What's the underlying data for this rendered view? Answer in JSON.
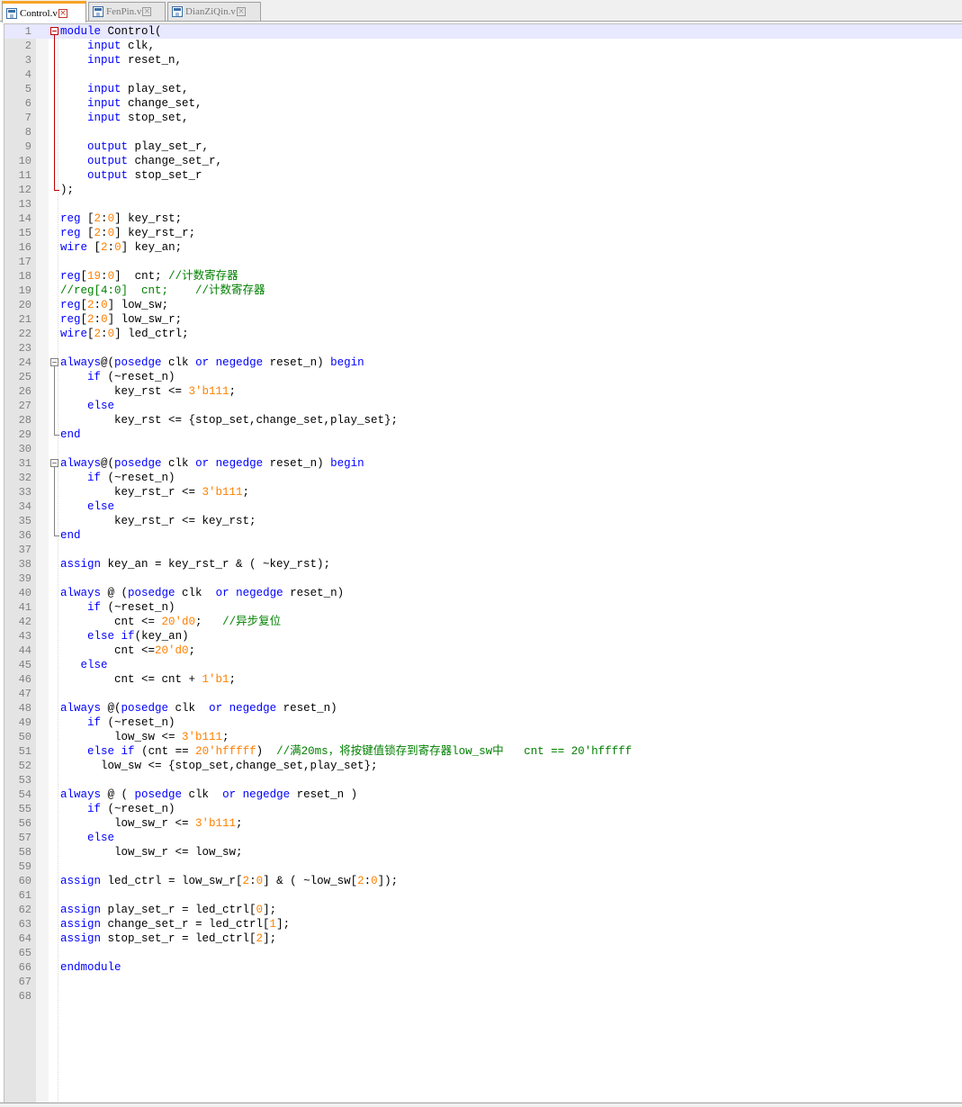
{
  "tabs": [
    {
      "label": "Control.v",
      "active": true
    },
    {
      "label": "FenPin.v",
      "active": false
    },
    {
      "label": "DianZiQin.v",
      "active": false
    }
  ],
  "current_line": 1,
  "lines": [
    [
      [
        "kw",
        "module"
      ],
      [
        "t",
        " Control("
      ]
    ],
    [
      [
        "t",
        "    "
      ],
      [
        "kw",
        "input"
      ],
      [
        "t",
        " clk,"
      ]
    ],
    [
      [
        "t",
        "    "
      ],
      [
        "kw",
        "input"
      ],
      [
        "t",
        " reset_n,"
      ]
    ],
    [],
    [
      [
        "t",
        "    "
      ],
      [
        "kw",
        "input"
      ],
      [
        "t",
        " play_set,"
      ]
    ],
    [
      [
        "t",
        "    "
      ],
      [
        "kw",
        "input"
      ],
      [
        "t",
        " change_set,"
      ]
    ],
    [
      [
        "t",
        "    "
      ],
      [
        "kw",
        "input"
      ],
      [
        "t",
        " stop_set,"
      ]
    ],
    [],
    [
      [
        "t",
        "    "
      ],
      [
        "kw",
        "output"
      ],
      [
        "t",
        " play_set_r,"
      ]
    ],
    [
      [
        "t",
        "    "
      ],
      [
        "kw",
        "output"
      ],
      [
        "t",
        " change_set_r,"
      ]
    ],
    [
      [
        "t",
        "    "
      ],
      [
        "kw",
        "output"
      ],
      [
        "t",
        " stop_set_r"
      ]
    ],
    [
      [
        "t",
        ");"
      ]
    ],
    [],
    [
      [
        "kw",
        "reg"
      ],
      [
        "t",
        " ["
      ],
      [
        "num",
        "2"
      ],
      [
        "t",
        ":"
      ],
      [
        "num",
        "0"
      ],
      [
        "t",
        "] key_rst;"
      ]
    ],
    [
      [
        "kw",
        "reg"
      ],
      [
        "t",
        " ["
      ],
      [
        "num",
        "2"
      ],
      [
        "t",
        ":"
      ],
      [
        "num",
        "0"
      ],
      [
        "t",
        "] key_rst_r;"
      ]
    ],
    [
      [
        "kw",
        "wire"
      ],
      [
        "t",
        " ["
      ],
      [
        "num",
        "2"
      ],
      [
        "t",
        ":"
      ],
      [
        "num",
        "0"
      ],
      [
        "t",
        "] key_an;"
      ]
    ],
    [],
    [
      [
        "kw",
        "reg"
      ],
      [
        "t",
        "["
      ],
      [
        "num",
        "19"
      ],
      [
        "t",
        ":"
      ],
      [
        "num",
        "0"
      ],
      [
        "t",
        "]  cnt; "
      ],
      [
        "cm",
        "//计数寄存器"
      ]
    ],
    [
      [
        "cm",
        "//reg[4:0]  cnt;    //计数寄存器"
      ]
    ],
    [
      [
        "kw",
        "reg"
      ],
      [
        "t",
        "["
      ],
      [
        "num",
        "2"
      ],
      [
        "t",
        ":"
      ],
      [
        "num",
        "0"
      ],
      [
        "t",
        "] low_sw;"
      ]
    ],
    [
      [
        "kw",
        "reg"
      ],
      [
        "t",
        "["
      ],
      [
        "num",
        "2"
      ],
      [
        "t",
        ":"
      ],
      [
        "num",
        "0"
      ],
      [
        "t",
        "] low_sw_r;"
      ]
    ],
    [
      [
        "kw",
        "wire"
      ],
      [
        "t",
        "["
      ],
      [
        "num",
        "2"
      ],
      [
        "t",
        ":"
      ],
      [
        "num",
        "0"
      ],
      [
        "t",
        "] led_ctrl;"
      ]
    ],
    [],
    [
      [
        "kw",
        "always"
      ],
      [
        "t",
        "@("
      ],
      [
        "kw",
        "posedge"
      ],
      [
        "t",
        " clk "
      ],
      [
        "kw",
        "or"
      ],
      [
        "t",
        " "
      ],
      [
        "kw",
        "negedge"
      ],
      [
        "t",
        " reset_n) "
      ],
      [
        "kw",
        "begin"
      ]
    ],
    [
      [
        "t",
        "    "
      ],
      [
        "kw",
        "if"
      ],
      [
        "t",
        " (~reset_n)"
      ]
    ],
    [
      [
        "t",
        "        key_rst <= "
      ],
      [
        "num",
        "3'b111"
      ],
      [
        "t",
        ";"
      ]
    ],
    [
      [
        "t",
        "    "
      ],
      [
        "kw",
        "else"
      ]
    ],
    [
      [
        "t",
        "        key_rst <= {stop_set,change_set,play_set};"
      ]
    ],
    [
      [
        "kw",
        "end"
      ]
    ],
    [],
    [
      [
        "kw",
        "always"
      ],
      [
        "t",
        "@("
      ],
      [
        "kw",
        "posedge"
      ],
      [
        "t",
        " clk "
      ],
      [
        "kw",
        "or"
      ],
      [
        "t",
        " "
      ],
      [
        "kw",
        "negedge"
      ],
      [
        "t",
        " reset_n) "
      ],
      [
        "kw",
        "begin"
      ]
    ],
    [
      [
        "t",
        "    "
      ],
      [
        "kw",
        "if"
      ],
      [
        "t",
        " (~reset_n)"
      ]
    ],
    [
      [
        "t",
        "        key_rst_r <= "
      ],
      [
        "num",
        "3'b111"
      ],
      [
        "t",
        ";"
      ]
    ],
    [
      [
        "t",
        "    "
      ],
      [
        "kw",
        "else"
      ]
    ],
    [
      [
        "t",
        "        key_rst_r <= key_rst;"
      ]
    ],
    [
      [
        "kw",
        "end"
      ]
    ],
    [],
    [
      [
        "kw",
        "assign"
      ],
      [
        "t",
        " key_an = key_rst_r & ( ~key_rst);"
      ]
    ],
    [],
    [
      [
        "kw",
        "always"
      ],
      [
        "t",
        " @ ("
      ],
      [
        "kw",
        "posedge"
      ],
      [
        "t",
        " clk  "
      ],
      [
        "kw",
        "or"
      ],
      [
        "t",
        " "
      ],
      [
        "kw",
        "negedge"
      ],
      [
        "t",
        " reset_n)"
      ]
    ],
    [
      [
        "t",
        "    "
      ],
      [
        "kw",
        "if"
      ],
      [
        "t",
        " (~reset_n)"
      ]
    ],
    [
      [
        "t",
        "        cnt <= "
      ],
      [
        "num",
        "20'd0"
      ],
      [
        "t",
        ";   "
      ],
      [
        "cm",
        "//异步复位"
      ]
    ],
    [
      [
        "t",
        "    "
      ],
      [
        "kw",
        "else"
      ],
      [
        "t",
        " "
      ],
      [
        "kw",
        "if"
      ],
      [
        "t",
        "(key_an)"
      ]
    ],
    [
      [
        "t",
        "        cnt <="
      ],
      [
        "num",
        "20'd0"
      ],
      [
        "t",
        ";"
      ]
    ],
    [
      [
        "t",
        "   "
      ],
      [
        "kw",
        "else"
      ]
    ],
    [
      [
        "t",
        "        cnt <= cnt + "
      ],
      [
        "num",
        "1'b1"
      ],
      [
        "t",
        ";"
      ]
    ],
    [],
    [
      [
        "kw",
        "always"
      ],
      [
        "t",
        " @("
      ],
      [
        "kw",
        "posedge"
      ],
      [
        "t",
        " clk  "
      ],
      [
        "kw",
        "or"
      ],
      [
        "t",
        " "
      ],
      [
        "kw",
        "negedge"
      ],
      [
        "t",
        " reset_n)"
      ]
    ],
    [
      [
        "t",
        "    "
      ],
      [
        "kw",
        "if"
      ],
      [
        "t",
        " (~reset_n)"
      ]
    ],
    [
      [
        "t",
        "        low_sw <= "
      ],
      [
        "num",
        "3'b111"
      ],
      [
        "t",
        ";"
      ]
    ],
    [
      [
        "t",
        "    "
      ],
      [
        "kw",
        "else"
      ],
      [
        "t",
        " "
      ],
      [
        "kw",
        "if"
      ],
      [
        "t",
        " (cnt == "
      ],
      [
        "num",
        "20'hfffff"
      ],
      [
        "t",
        ")  "
      ],
      [
        "cm",
        "//满20ms，将按键值锁存到寄存器low_sw中   cnt == 20'hfffff"
      ]
    ],
    [
      [
        "t",
        "      low_sw <= {stop_set,change_set,play_set};"
      ]
    ],
    [],
    [
      [
        "kw",
        "always"
      ],
      [
        "t",
        " @ ( "
      ],
      [
        "kw",
        "posedge"
      ],
      [
        "t",
        " clk  "
      ],
      [
        "kw",
        "or"
      ],
      [
        "t",
        " "
      ],
      [
        "kw",
        "negedge"
      ],
      [
        "t",
        " reset_n )"
      ]
    ],
    [
      [
        "t",
        "    "
      ],
      [
        "kw",
        "if"
      ],
      [
        "t",
        " (~reset_n)"
      ]
    ],
    [
      [
        "t",
        "        low_sw_r <= "
      ],
      [
        "num",
        "3'b111"
      ],
      [
        "t",
        ";"
      ]
    ],
    [
      [
        "t",
        "    "
      ],
      [
        "kw",
        "else"
      ]
    ],
    [
      [
        "t",
        "        low_sw_r <= low_sw;"
      ]
    ],
    [],
    [
      [
        "kw",
        "assign"
      ],
      [
        "t",
        " led_ctrl = low_sw_r["
      ],
      [
        "num",
        "2"
      ],
      [
        "t",
        ":"
      ],
      [
        "num",
        "0"
      ],
      [
        "t",
        "] & ( ~low_sw["
      ],
      [
        "num",
        "2"
      ],
      [
        "t",
        ":"
      ],
      [
        "num",
        "0"
      ],
      [
        "t",
        "]);"
      ]
    ],
    [],
    [
      [
        "kw",
        "assign"
      ],
      [
        "t",
        " play_set_r = led_ctrl["
      ],
      [
        "num",
        "0"
      ],
      [
        "t",
        "];"
      ]
    ],
    [
      [
        "kw",
        "assign"
      ],
      [
        "t",
        " change_set_r = led_ctrl["
      ],
      [
        "num",
        "1"
      ],
      [
        "t",
        "];"
      ]
    ],
    [
      [
        "kw",
        "assign"
      ],
      [
        "t",
        " stop_set_r = led_ctrl["
      ],
      [
        "num",
        "2"
      ],
      [
        "t",
        "];"
      ]
    ],
    [],
    [
      [
        "kw",
        "endmodule"
      ]
    ],
    [],
    []
  ]
}
